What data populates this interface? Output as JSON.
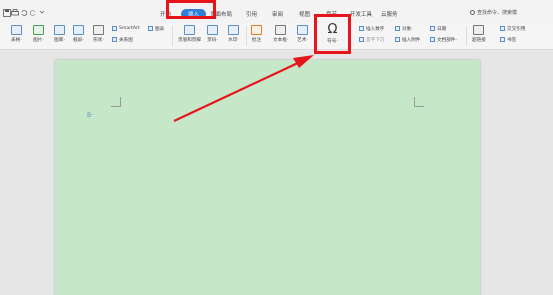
{
  "menubar": {
    "tabs": [
      {
        "label": "开始",
        "active": false
      },
      {
        "label": "插入",
        "active": true
      },
      {
        "label": "页面布局",
        "active": false
      },
      {
        "label": "引用",
        "active": false
      },
      {
        "label": "审阅",
        "active": false
      },
      {
        "label": "视图",
        "active": false
      },
      {
        "label": "章节",
        "active": false
      },
      {
        "label": "开发工具",
        "active": false
      },
      {
        "label": "云服务",
        "active": false
      }
    ],
    "search": "查找命令、搜索模"
  },
  "ribbon": {
    "items": [
      {
        "label": "表格·"
      },
      {
        "label": "图片·"
      },
      {
        "label": "图库·"
      },
      {
        "label": "截屏·"
      },
      {
        "label": "形状·"
      },
      {
        "label": "SmartArt"
      },
      {
        "label": "图表"
      },
      {
        "label": "关系图"
      },
      {
        "label": "页眉和页脚"
      },
      {
        "label": "页码·"
      },
      {
        "label": "水印·"
      },
      {
        "label": "批注"
      },
      {
        "label": "文本框·"
      },
      {
        "label": "艺术·"
      },
      {
        "label": "符号·"
      },
      {
        "label": "插入数字"
      },
      {
        "label": "对象·"
      },
      {
        "label": "日期"
      },
      {
        "label": "首字下沉"
      },
      {
        "label": "插入附件"
      },
      {
        "label": "文档部件·"
      },
      {
        "label": "超链接"
      },
      {
        "label": "交叉引用"
      },
      {
        "label": "书签"
      }
    ],
    "symbol_glyph": "Ω"
  },
  "document": {
    "cursor_mark": "B·"
  },
  "colors": {
    "accent": "#2e7fd8",
    "highlight": "#e8141b",
    "page": "#c6e8c9"
  }
}
